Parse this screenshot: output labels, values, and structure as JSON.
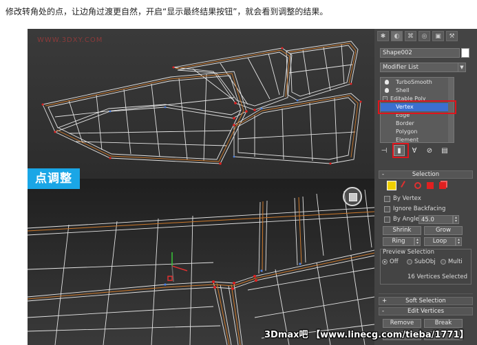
{
  "caption": "修改转角处的点，让边角过渡更自然，开启“显示最终结果按钮”，就会看到调整的结果。",
  "viewport": {
    "watermark": "WWW.3DXY.COM",
    "badge": "点调整"
  },
  "panel": {
    "object_name": "Shape002",
    "modifier_list": "Modifier List",
    "stack": [
      {
        "label": "TurboSmooth",
        "kind": "modifier"
      },
      {
        "label": "Shell",
        "kind": "modifier"
      },
      {
        "label": "Editable Poly",
        "kind": "base"
      },
      {
        "label": "Vertex",
        "kind": "sub",
        "selected": true
      },
      {
        "label": "Edge",
        "kind": "sub"
      },
      {
        "label": "Border",
        "kind": "sub"
      },
      {
        "label": "Polygon",
        "kind": "sub"
      },
      {
        "label": "Element",
        "kind": "sub"
      }
    ],
    "selection": {
      "title": "Selection",
      "by_vertex": "By Vertex",
      "ignore_backfacing": "Ignore Backfacing",
      "by_angle": "By Angle:",
      "angle_value": "45.0",
      "shrink": "Shrink",
      "grow": "Grow",
      "ring": "Ring",
      "loop": "Loop",
      "preview_title": "Preview Selection",
      "preview_off": "Off",
      "preview_subobj": "SubObj",
      "preview_multi": "Multi",
      "status": "16 Vertices Selected"
    },
    "soft_selection": "Soft Selection",
    "edit_vertices": "Edit Vertices",
    "remove": "Remove",
    "break": "Break"
  },
  "footer_watermark": "3Dmax吧 【www.linecg.com/tieba/1771】",
  "colors": {
    "viewport_bg": "#2f2f2f",
    "panel_bg": "#444444",
    "highlight": "#e0141c",
    "badge": "#1aa6e6",
    "selection_blue": "#3b6fd0"
  }
}
